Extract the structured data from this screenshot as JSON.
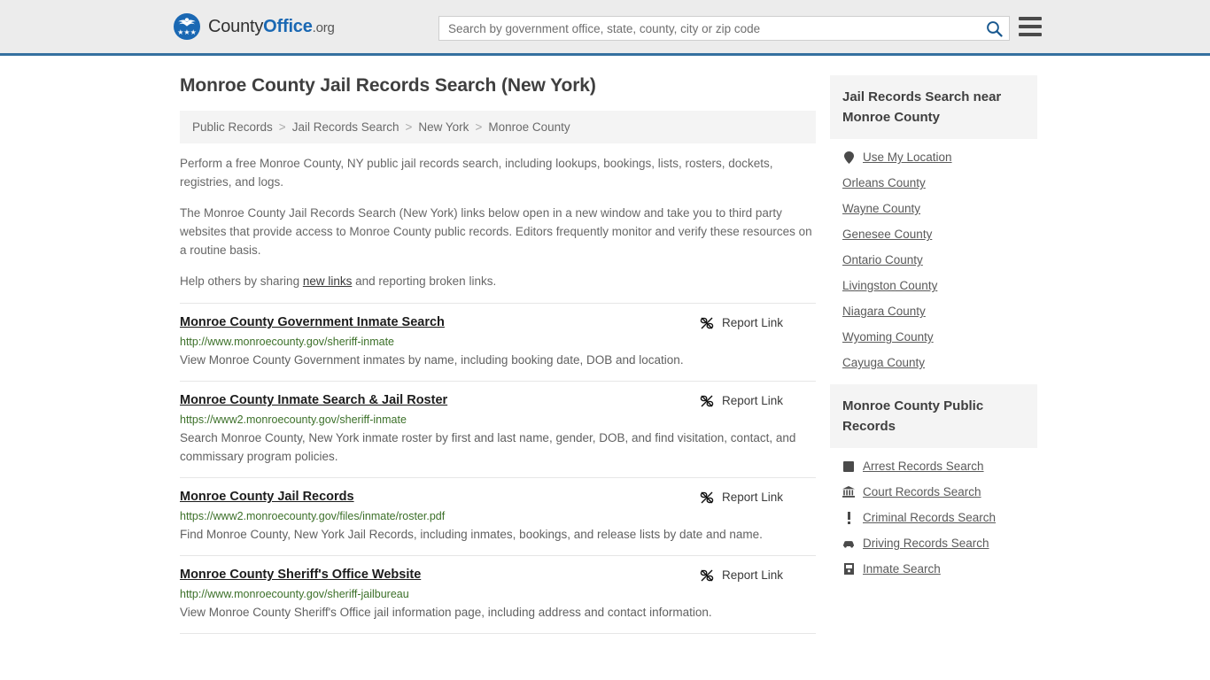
{
  "header": {
    "logo": {
      "part1": "County",
      "part2": "Office",
      "tld": ".org"
    },
    "search": {
      "placeholder": "Search by government office, state, county, city or zip code",
      "value": ""
    },
    "accent_color": "#35709f",
    "background_color": "#ececec"
  },
  "page": {
    "title": "Monroe County Jail Records Search (New York)"
  },
  "breadcrumb": {
    "items": [
      {
        "label": "Public Records"
      },
      {
        "label": "Jail Records Search"
      },
      {
        "label": "New York"
      },
      {
        "label": "Monroe County"
      }
    ],
    "separator": ">"
  },
  "intro": {
    "p1": "Perform a free Monroe County, NY public jail records search, including lookups, bookings, lists, rosters, dockets, registries, and logs.",
    "p2": "The Monroe County Jail Records Search (New York) links below open in a new window and take you to third party websites that provide access to Monroe County public records. Editors frequently monitor and verify these resources on a routine basis.",
    "p3_before": "Help others by sharing ",
    "p3_link": "new links",
    "p3_after": " and reporting broken links."
  },
  "results": {
    "report_label": "Report Link",
    "items": [
      {
        "title": "Monroe County Government Inmate Search",
        "url": "http://www.monroecounty.gov/sheriff-inmate",
        "description": "View Monroe County Government inmates by name, including booking date, DOB and location."
      },
      {
        "title": "Monroe County Inmate Search & Jail Roster",
        "url": "https://www2.monroecounty.gov/sheriff-inmate",
        "description": "Search Monroe County, New York inmate roster by first and last name, gender, DOB, and find visitation, contact, and commissary program policies."
      },
      {
        "title": "Monroe County Jail Records",
        "url": "https://www2.monroecounty.gov/files/inmate/roster.pdf",
        "description": "Find Monroe County, New York Jail Records, including inmates, bookings, and release lists by date and name."
      },
      {
        "title": "Monroe County Sheriff's Office Website",
        "url": "http://www.monroecounty.gov/sheriff-jailbureau",
        "description": "View Monroe County Sheriff's Office jail information page, including address and contact information."
      }
    ]
  },
  "sidebar": {
    "nearby": {
      "heading": "Jail Records Search near Monroe County",
      "items": [
        {
          "label": "Use My Location",
          "icon": "map-pin-icon"
        },
        {
          "label": "Orleans County",
          "icon": ""
        },
        {
          "label": "Wayne County",
          "icon": ""
        },
        {
          "label": "Genesee County",
          "icon": ""
        },
        {
          "label": "Ontario County",
          "icon": ""
        },
        {
          "label": "Livingston County",
          "icon": ""
        },
        {
          "label": "Niagara County",
          "icon": ""
        },
        {
          "label": "Wyoming County",
          "icon": ""
        },
        {
          "label": "Cayuga County",
          "icon": ""
        }
      ]
    },
    "public_records": {
      "heading": "Monroe County Public Records",
      "items": [
        {
          "label": "Arrest Records Search",
          "icon": "square-icon"
        },
        {
          "label": "Court Records Search",
          "icon": "courthouse-icon"
        },
        {
          "label": "Criminal Records Search",
          "icon": "exclamation-icon"
        },
        {
          "label": "Driving Records Search",
          "icon": "car-icon"
        },
        {
          "label": "Inmate Search",
          "icon": "door-icon"
        }
      ]
    }
  }
}
